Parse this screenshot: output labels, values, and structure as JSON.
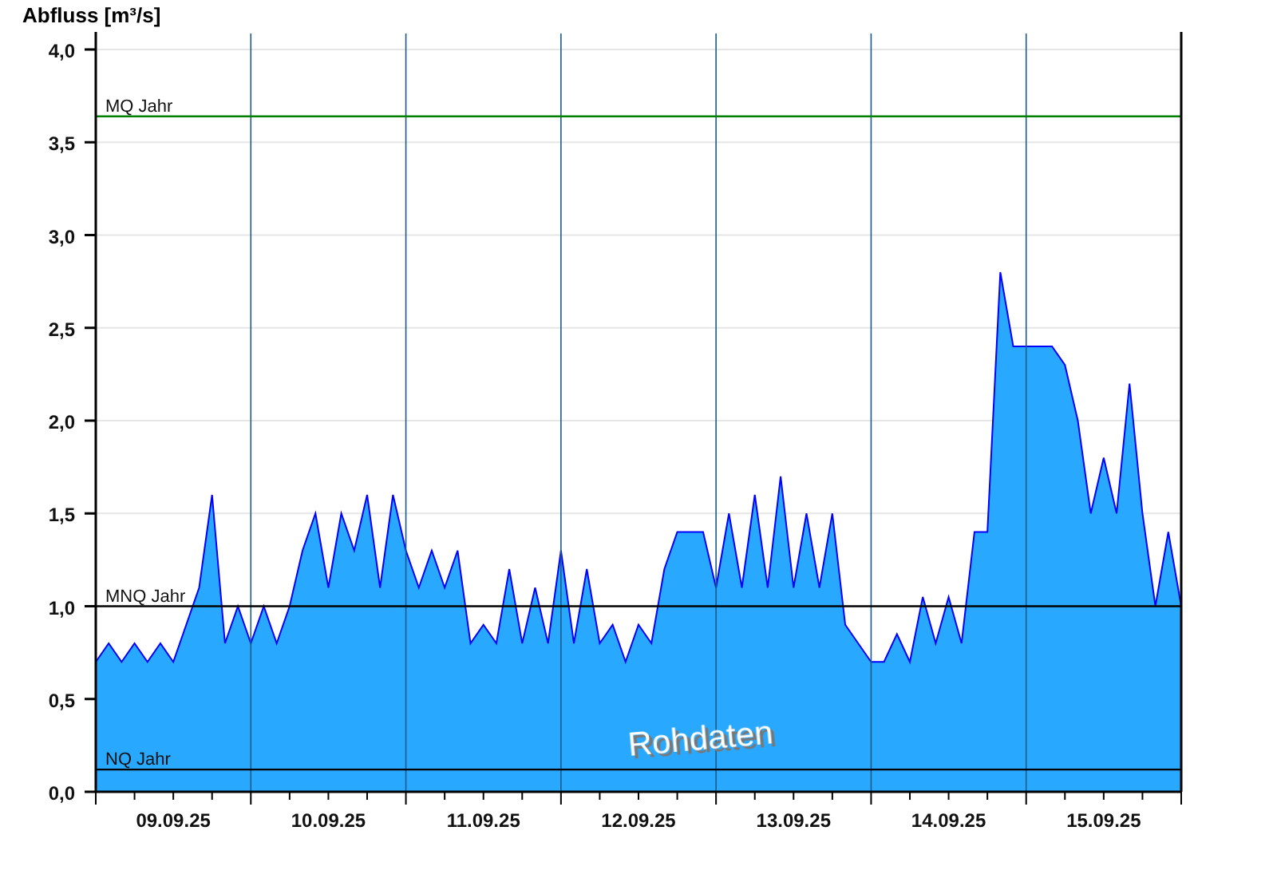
{
  "chart_data": {
    "type": "area",
    "ylabel": "Abfluss [m³/s]",
    "categories": [
      null,
      null,
      null,
      null,
      null,
      null,
      "09.09.25",
      null,
      null,
      null,
      null,
      null,
      null,
      null,
      null,
      null,
      null,
      null,
      "10.09.25",
      null,
      null,
      null,
      null,
      null,
      null,
      null,
      null,
      null,
      null,
      null,
      "11.09.25",
      null,
      null,
      null,
      null,
      null,
      null,
      null,
      null,
      null,
      null,
      null,
      "12.09.25",
      null,
      null,
      null,
      null,
      null,
      null,
      null,
      null,
      null,
      null,
      null,
      "13.09.25",
      null,
      null,
      null,
      null,
      null,
      null,
      null,
      null,
      null,
      null,
      null,
      "14.09.25",
      null,
      null,
      null,
      null,
      null,
      null,
      null,
      null,
      null,
      null,
      null,
      "15.09.25",
      null,
      null,
      null,
      null,
      null,
      null
    ],
    "series": [
      {
        "color": "#29a8ff",
        "values": [
          0.7,
          0.8,
          0.7,
          0.8,
          0.7,
          0.8,
          0.7,
          0.9,
          1.1,
          1.6,
          0.8,
          1.0,
          0.8,
          1.0,
          0.8,
          1.0,
          1.3,
          1.5,
          1.1,
          1.5,
          1.3,
          1.6,
          1.1,
          1.6,
          1.3,
          1.1,
          1.3,
          1.1,
          1.3,
          0.8,
          0.9,
          0.8,
          1.2,
          0.8,
          1.1,
          0.8,
          1.3,
          0.8,
          1.2,
          0.8,
          0.9,
          0.7,
          0.9,
          0.8,
          1.2,
          1.4,
          1.4,
          1.4,
          1.1,
          1.5,
          1.1,
          1.6,
          1.1,
          1.7,
          1.1,
          1.5,
          1.1,
          1.5,
          0.9,
          0.8,
          0.7,
          0.7,
          0.85,
          0.7,
          1.05,
          0.8,
          1.05,
          0.8,
          1.4,
          1.4,
          2.8,
          2.4,
          2.4,
          2.4,
          2.4,
          2.3,
          2.0,
          1.5,
          1.8,
          1.5,
          2.2,
          1.5,
          1.0,
          1.4,
          1.0
        ]
      }
    ],
    "ylim": [
      0,
      4
    ],
    "yticks": [
      {
        "value": 0,
        "label": "0,0"
      },
      {
        "value": 0.5,
        "label": "0,5"
      },
      {
        "value": 1,
        "label": "1,0"
      },
      {
        "value": 1.5,
        "label": "1,5"
      },
      {
        "value": 2,
        "label": "2,0"
      },
      {
        "value": 2.5,
        "label": "2,5"
      },
      {
        "value": 3,
        "label": "3,0"
      },
      {
        "value": 3.5,
        "label": "3,5"
      },
      {
        "value": 4,
        "label": "4,0"
      }
    ],
    "grid": true,
    "ref_lines": [
      {
        "axis": "y",
        "value": 3.64,
        "label": "MQ Jahr",
        "color": "#008000"
      },
      {
        "axis": "y",
        "value": 1.0,
        "label": "MNQ Jahr",
        "color": "#000000"
      },
      {
        "axis": "y",
        "value": 0.12,
        "label": "NQ Jahr",
        "color": "#000000"
      }
    ]
  },
  "overlay_text": "Rohdaten"
}
